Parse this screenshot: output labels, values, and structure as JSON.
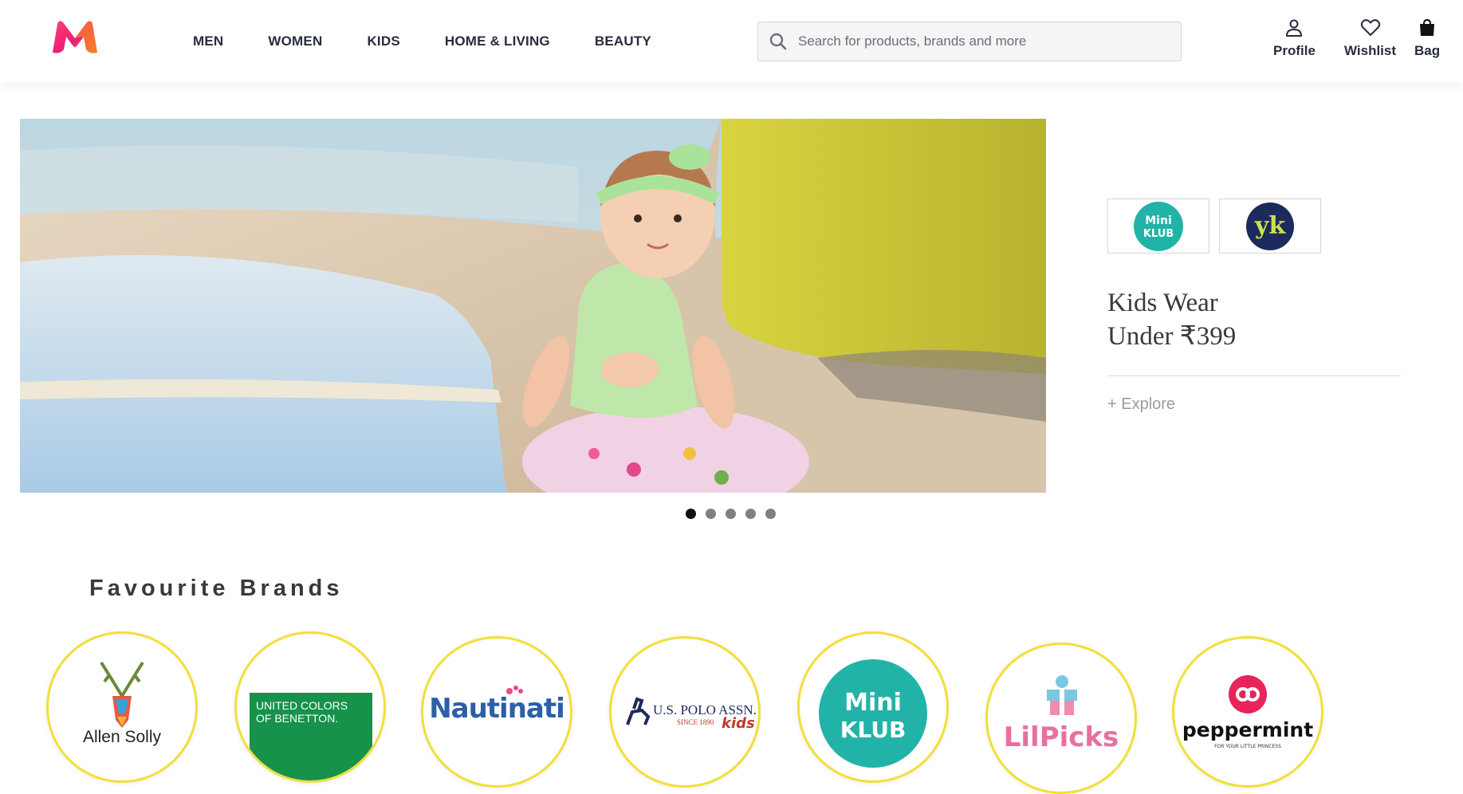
{
  "header": {
    "logo_icon": "myntra-logo-icon",
    "nav": [
      {
        "label": "MEN"
      },
      {
        "label": "WOMEN"
      },
      {
        "label": "KIDS"
      },
      {
        "label": "HOME & LIVING"
      },
      {
        "label": "BEAUTY"
      }
    ],
    "search": {
      "placeholder": "Search for products, brands and more",
      "value": "",
      "icon": "search-icon"
    },
    "actions": [
      {
        "label": "Profile",
        "icon": "user-icon"
      },
      {
        "label": "Wishlist",
        "icon": "heart-icon"
      },
      {
        "label": "Bag",
        "icon": "bag-icon"
      }
    ]
  },
  "banner": {
    "image": "baby-on-beach-photo",
    "slides": 5,
    "active_slide": 1
  },
  "promo": {
    "brand_logos": [
      {
        "name": "mini-klub-logo",
        "text_line1": "Mini",
        "text_line2": "KLUB",
        "color": "#22b3a8"
      },
      {
        "name": "you-got-plan-b-logo",
        "text": "yk",
        "color": "#1c2a5c"
      }
    ],
    "title_line1": "Kids Wear",
    "title_line2": "Under ₹399",
    "link": "+ Explore"
  },
  "favourite_brands": {
    "title": "Favourite Brands",
    "brands": [
      {
        "name": "allen-solly",
        "label": "Allen Solly"
      },
      {
        "name": "united-colors-of-benetton",
        "label_line1": "UNITED COLORS",
        "label_line2": "OF BENETTON."
      },
      {
        "name": "nautinati",
        "label": "Nautinati"
      },
      {
        "name": "us-polo-assn-kids",
        "label_line1": "U.S. POLO ASSN.",
        "label_line2": "SINCE 1890",
        "label_line3": "kids"
      },
      {
        "name": "mini-klub",
        "label_line1": "Mini",
        "label_line2": "KLUB"
      },
      {
        "name": "lilpicks",
        "label": "LilPicks"
      },
      {
        "name": "peppermint",
        "label": "peppermint",
        "tagline": "FOR YOUR LITTLE PRINCESS"
      }
    ]
  },
  "colors": {
    "brand_pink": "#ff3f6c",
    "brand_orange": "#f97e2a",
    "text_dark": "#282c3f",
    "circle_border": "#f2df3a",
    "benetton_green": "#16924a",
    "mini_klub_teal": "#22b3a8"
  }
}
